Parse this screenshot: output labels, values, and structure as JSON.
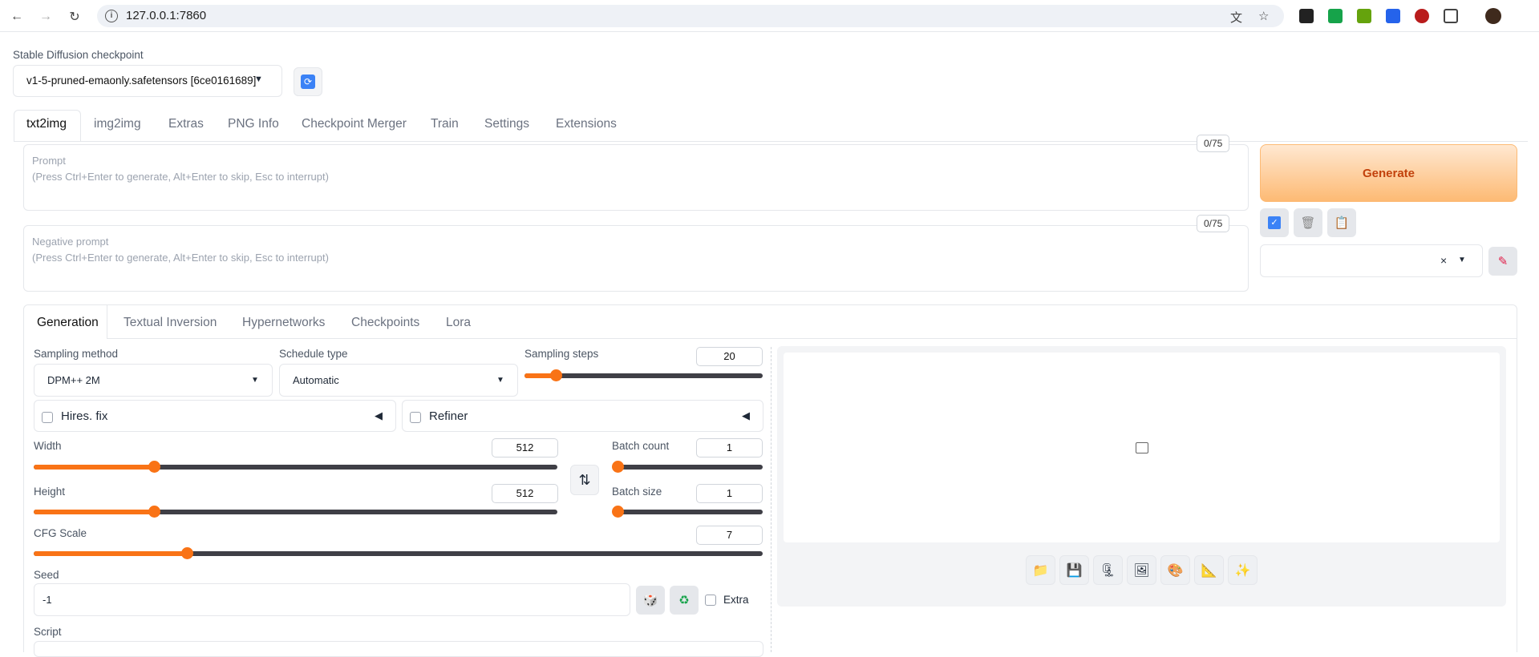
{
  "browser": {
    "url": "127.0.0.1:7860",
    "icons": [
      "back-icon",
      "forward-icon",
      "reload-icon",
      "site-info-icon",
      "translate-icon",
      "bookmark-star-icon",
      "extension-icons",
      "extensions-puzzle-icon",
      "profile-avatar"
    ]
  },
  "checkpoint": {
    "label": "Stable Diffusion checkpoint",
    "value": "v1-5-pruned-emaonly.safetensors [6ce0161689]",
    "refresh_icon": "refresh-icon"
  },
  "main_tabs": [
    "txt2img",
    "img2img",
    "Extras",
    "PNG Info",
    "Checkpoint Merger",
    "Train",
    "Settings",
    "Extensions"
  ],
  "prompt": {
    "label": "Prompt",
    "placeholder": "(Press Ctrl+Enter to generate, Alt+Enter to skip, Esc to interrupt)",
    "counter": "0/75"
  },
  "negative_prompt": {
    "label": "Negative prompt",
    "placeholder": "(Press Ctrl+Enter to generate, Alt+Enter to skip, Esc to interrupt)",
    "counter": "0/75"
  },
  "generate": {
    "label": "Generate",
    "accent": "#f97316",
    "tool_icons": [
      "apply-styles-icon",
      "trash-icon",
      "clipboard-icon"
    ],
    "styles_clear": "×",
    "edit_icon": "pencil-icon"
  },
  "sub_tabs": [
    "Generation",
    "Textual Inversion",
    "Hypernetworks",
    "Checkpoints",
    "Lora"
  ],
  "params": {
    "sampling_method": {
      "label": "Sampling method",
      "value": "DPM++ 2M"
    },
    "schedule_type": {
      "label": "Schedule type",
      "value": "Automatic"
    },
    "sampling_steps": {
      "label": "Sampling steps",
      "value": "20",
      "fraction": 0.13
    },
    "hires_fix": {
      "label": "Hires. fix",
      "checked": false
    },
    "refiner": {
      "label": "Refiner",
      "checked": false
    },
    "width": {
      "label": "Width",
      "value": "512",
      "fraction": 0.23
    },
    "height": {
      "label": "Height",
      "value": "512",
      "fraction": 0.23
    },
    "batch_count": {
      "label": "Batch count",
      "value": "1",
      "fraction": 0.0
    },
    "batch_size": {
      "label": "Batch size",
      "value": "1",
      "fraction": 0.0
    },
    "cfg_scale": {
      "label": "CFG Scale",
      "value": "7",
      "fraction": 0.21
    },
    "seed": {
      "label": "Seed",
      "value": "-1",
      "extra_label": "Extra"
    },
    "script": {
      "label": "Script"
    }
  },
  "output": {
    "tool_icons": [
      "folder-icon",
      "save-icon",
      "zip-icon",
      "send-to-img2img-icon",
      "send-to-inpaint-icon",
      "send-to-extras-icon",
      "sparkle-icon"
    ]
  }
}
